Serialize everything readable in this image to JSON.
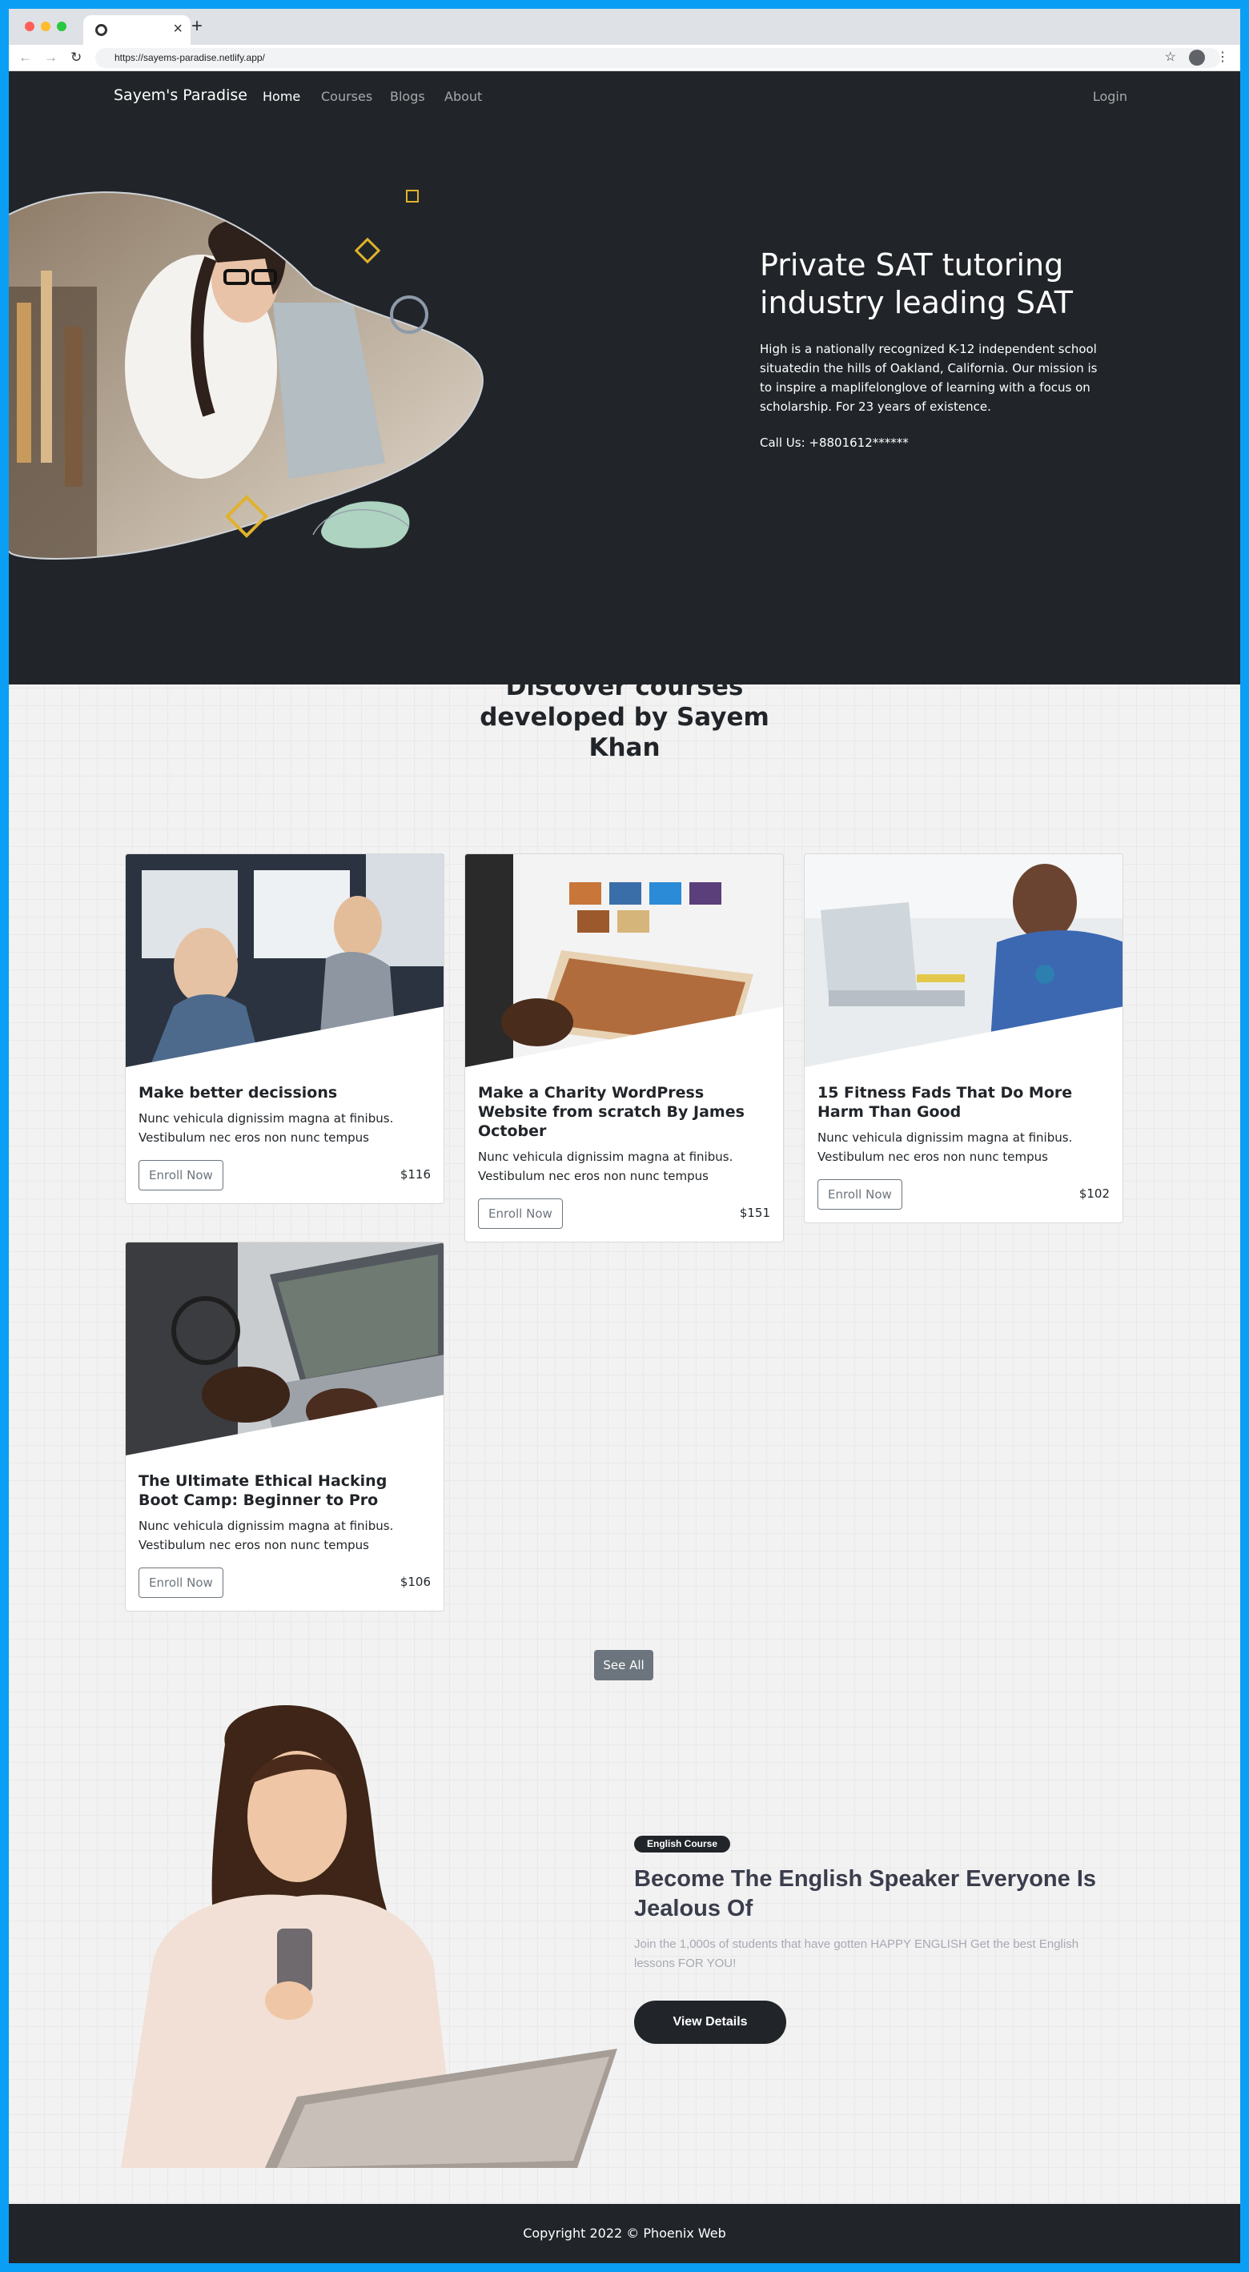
{
  "browser": {
    "url": "https://sayems-paradise.netlify.app/",
    "tab_close": "×",
    "new_tab": "+",
    "back": "←",
    "forward": "→",
    "reload": "↻",
    "star": "☆",
    "kebab": "⋮"
  },
  "navbar": {
    "brand": "Sayem's Paradise",
    "links": [
      "Home",
      "Courses",
      "Blogs",
      "About"
    ],
    "login": "Login"
  },
  "hero": {
    "title": "Private SAT tutoring industry leading SAT",
    "description": "High is a nationally recognized K-12 independent school situatedin the hills of Oakland, California. Our mission is to inspire a maplifelonglove of learning with a focus on scholarship. For 23 years of existence.",
    "call": "Call Us: +8801612******"
  },
  "courses": {
    "heading": "Discover courses developed by Sayem Khan",
    "enroll_label": "Enroll Now",
    "items": [
      {
        "title": "Make better decissions",
        "text": "Nunc vehicula dignissim magna at finibus. Vestibulum nec eros non nunc tempus",
        "price": "$116"
      },
      {
        "title": "Make a Charity WordPress Website from scratch By James October",
        "text": "Nunc vehicula dignissim magna at finibus. Vestibulum nec eros non nunc tempus",
        "price": "$151"
      },
      {
        "title": "15 Fitness Fads That Do More Harm Than Good",
        "text": "Nunc vehicula dignissim magna at finibus. Vestibulum nec eros non nunc tempus",
        "price": "$102"
      },
      {
        "title": "The Ultimate Ethical Hacking Boot Camp: Beginner to Pro",
        "text": "Nunc vehicula dignissim magna at finibus. Vestibulum nec eros non nunc tempus",
        "price": "$106"
      }
    ],
    "see_all": "See All"
  },
  "promo": {
    "badge": "English Course",
    "title": "Become The English Speaker Everyone Is Jealous Of",
    "description": "Join the 1,000s of students that have gotten HAPPY ENGLISH Get the best English lessons FOR YOU!",
    "button": "View Details"
  },
  "footer": {
    "copyright": "Copyright 2022 © Phoenix Web"
  }
}
